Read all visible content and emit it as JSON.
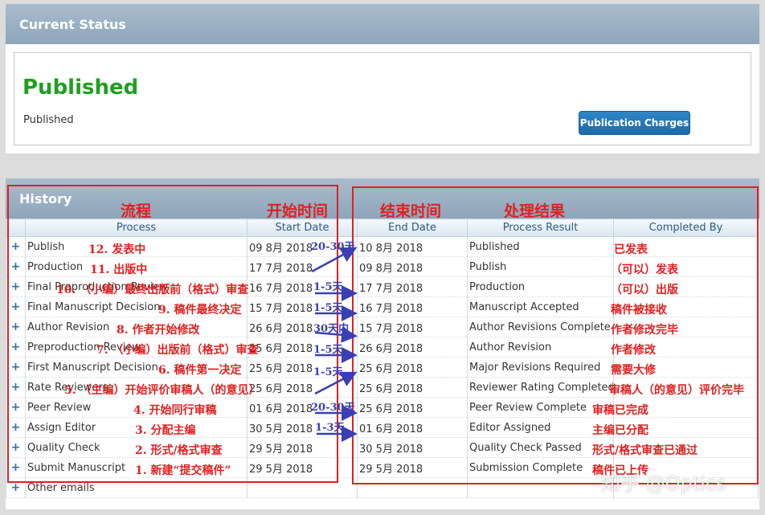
{
  "status": {
    "header": "Current Status",
    "title": "Published",
    "text": "Published",
    "button": "Publication Charges"
  },
  "history": {
    "header": "History",
    "columns": [
      "Process",
      "Start Date",
      "End Date",
      "Process Result",
      "Completed By"
    ],
    "rows": [
      {
        "process": "Publish",
        "start": "09 8月 2018",
        "end": "10 8月 2018",
        "result": "Published"
      },
      {
        "process": "Production",
        "start": "17 7月 2018",
        "end": "09 8月 2018",
        "result": "Publish"
      },
      {
        "process": "Final Preproduction Review",
        "start": "16 7月 2018",
        "end": "17 7月 2018",
        "result": "Production"
      },
      {
        "process": "Final Manuscript Decision",
        "start": "15 7月 2018",
        "end": "16 7月 2018",
        "result": "Manuscript Accepted"
      },
      {
        "process": "Author Revision",
        "start": "26 6月 2018",
        "end": "15 7月 2018",
        "result": "Author Revisions Complete"
      },
      {
        "process": "Preproduction Review",
        "start": "25 6月 2018",
        "end": "26 6月 2018",
        "result": "Author Revision"
      },
      {
        "process": "First Manuscript Decision",
        "start": "25 6月 2018",
        "end": "25 6月 2018",
        "result": "Major Revisions Required"
      },
      {
        "process": "Rate Reviewers",
        "start": "25 6月 2018",
        "end": "25 6月 2018",
        "result": "Reviewer Rating Completed"
      },
      {
        "process": "Peer Review",
        "start": "01 6月 2018",
        "end": "25 6月 2018",
        "result": "Peer Review Complete"
      },
      {
        "process": "Assign Editor",
        "start": "30 5月 2018",
        "end": "01 6月 2018",
        "result": "Editor Assigned"
      },
      {
        "process": "Quality Check",
        "start": "29 5月 2018",
        "end": "30 5月 2018",
        "result": "Quality Check Passed"
      },
      {
        "process": "Submit Manuscript",
        "start": "29 5月 2018",
        "end": "29 5月 2018",
        "result": "Submission Complete"
      },
      {
        "process": "Other emails",
        "start": "",
        "end": "",
        "result": ""
      }
    ],
    "expand_symbol": "+"
  },
  "annotations": {
    "col_process": "流程",
    "col_start": "开始时间",
    "col_end": "结束时间",
    "col_result": "处理结果",
    "process_notes": [
      "12. 发表中",
      "11. 出版中",
      "10. （小编）最终出版前（格式）审查",
      "9. 稿件最终决定",
      "8. 作者开始修改",
      "7. （小编）出版前（格式）审查",
      "6. 稿件第一决定",
      "5. （主编）开始评价审稿人（的意见）",
      "4. 开始同行审稿",
      "3. 分配主编",
      "2. 形式/格式审查",
      "1. 新建“提交稿件”"
    ],
    "result_notes": [
      "已发表",
      "（可以）发表",
      "（可以）出版",
      "稿件被接收",
      "作者修改完毕",
      "作者修改",
      "需要大修",
      "审稿人（的意见）评价完毕",
      "审稿已完成",
      "主编已分配",
      "形式/格式审查已通过",
      "稿件已上传"
    ],
    "durations": [
      "20-30天",
      "1-5天",
      "1-5天",
      "30天内",
      "1-5天",
      "1-5天",
      "20-30天",
      "1-3天"
    ]
  },
  "watermark": "知乎 @Optics",
  "colors": {
    "published_green": "#1ea01e",
    "annotation_red": "#e02020",
    "arrow_blue": "#3a3fb4",
    "header_blue": "#2d5b86"
  }
}
